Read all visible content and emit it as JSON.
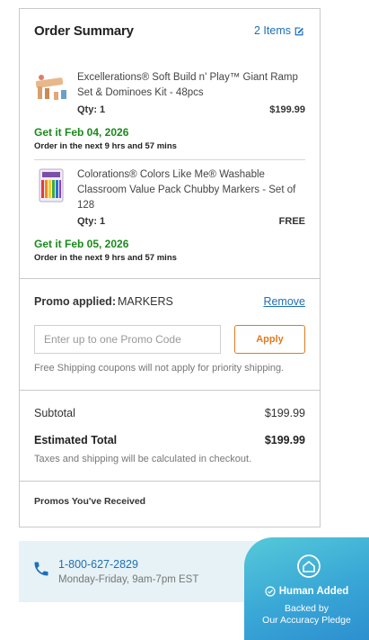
{
  "summary": {
    "title": "Order Summary",
    "items_link": "2 Items"
  },
  "items": [
    {
      "name": "Excellerations® Soft Build n' Play™ Giant Ramp Set & Dominoes Kit - 48pcs",
      "qty": "Qty: 1",
      "price": "$199.99",
      "delivery": "Get it Feb 04, 2026",
      "order_by": "Order in the next 9 hrs and 57 mins"
    },
    {
      "name": "Colorations® Colors Like Me® Washable Classroom Value Pack Chubby Markers - Set of 128",
      "qty": "Qty: 1",
      "price": "FREE",
      "delivery": "Get it Feb 05, 2026",
      "order_by": "Order in the next 9 hrs and 57 mins"
    }
  ],
  "promo": {
    "applied_label": "Promo applied:",
    "code": "MARKERS",
    "remove": "Remove",
    "placeholder": "Enter up to one Promo Code",
    "apply": "Apply",
    "note": "Free Shipping coupons will not apply for priority shipping."
  },
  "totals": {
    "subtotal_label": "Subtotal",
    "subtotal": "$199.99",
    "total_label": "Estimated Total",
    "total": "$199.99",
    "note": "Taxes and shipping will be calculated in checkout."
  },
  "promos_received": "Promos You've Received",
  "contact": {
    "phone": "1-800-627-2829",
    "hours": "Monday-Friday, 9am-7pm EST"
  },
  "badge": {
    "title": "Human Added",
    "line1": "Backed by",
    "line2": "Our Accuracy Pledge"
  },
  "colors": {
    "link": "#1f6fb6",
    "delivery": "#1a8a1a",
    "apply": "#e07b20",
    "badge": "#39a7d6"
  }
}
